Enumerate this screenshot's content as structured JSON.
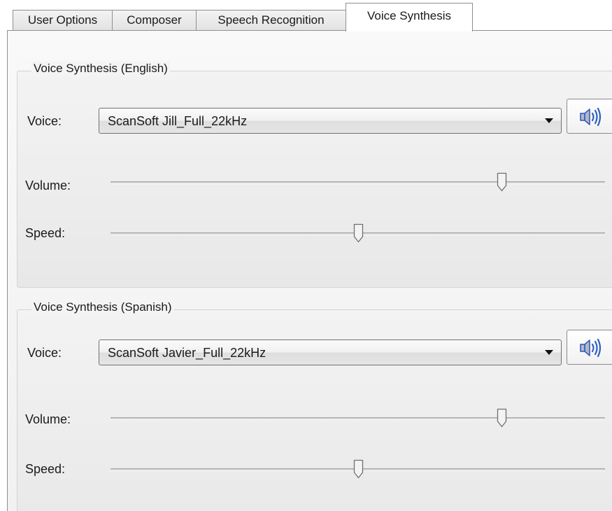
{
  "tabs": [
    {
      "label": "User Options",
      "active": false
    },
    {
      "label": "Composer",
      "active": false
    },
    {
      "label": "Speech Recognition",
      "active": false
    },
    {
      "label": "Voice Synthesis",
      "active": true
    }
  ],
  "groups": [
    {
      "legend": "Voice Synthesis (English)",
      "voice_label": "Voice:",
      "voice_value": "ScanSoft Jill_Full_22kHz",
      "volume_label": "Volume:",
      "volume_fraction": 0.79,
      "speed_label": "Speed:",
      "speed_fraction": 0.5
    },
    {
      "legend": "Voice Synthesis (Spanish)",
      "voice_label": "Voice:",
      "voice_value": "ScanSoft Javier_Full_22kHz",
      "volume_label": "Volume:",
      "volume_fraction": 0.79,
      "speed_label": "Speed:",
      "speed_fraction": 0.5
    }
  ],
  "icons": {
    "speaker": "speaker-icon",
    "dropdown": "chevron-down-icon"
  },
  "colors": {
    "speaker_blue": "#2f5fbf",
    "speaker_body": "#b7b7c7"
  }
}
